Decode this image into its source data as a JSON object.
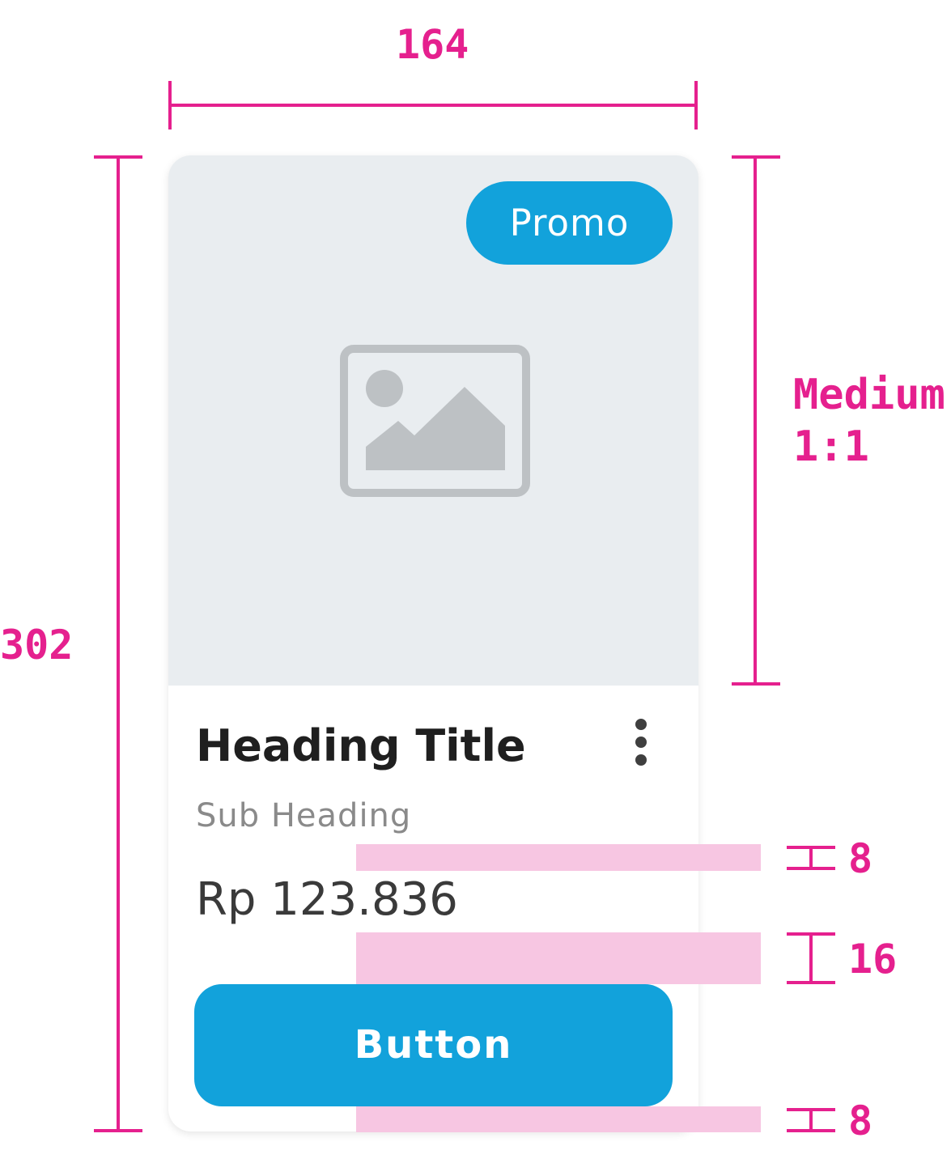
{
  "annotations": {
    "card_width": "164",
    "card_height": "302",
    "media_ratio_line1": "Medium",
    "media_ratio_line2": "1:1",
    "gap_price": "8",
    "gap_button": "16",
    "gap_bottom": "8"
  },
  "card": {
    "badge_label": "Promo",
    "media_icon": "image-placeholder-icon",
    "title": "Heading Title",
    "subtitle": "Sub Heading",
    "price": "Rp 123.836",
    "button_label": "Button",
    "menu_icon": "more-vertical-icon"
  },
  "colors": {
    "annotation": "#E5208E",
    "spacer": "#F7C6E2",
    "accent": "#12A2DB",
    "media_bg": "#E9EDF0",
    "placeholder_icon": "#BDC1C4"
  }
}
